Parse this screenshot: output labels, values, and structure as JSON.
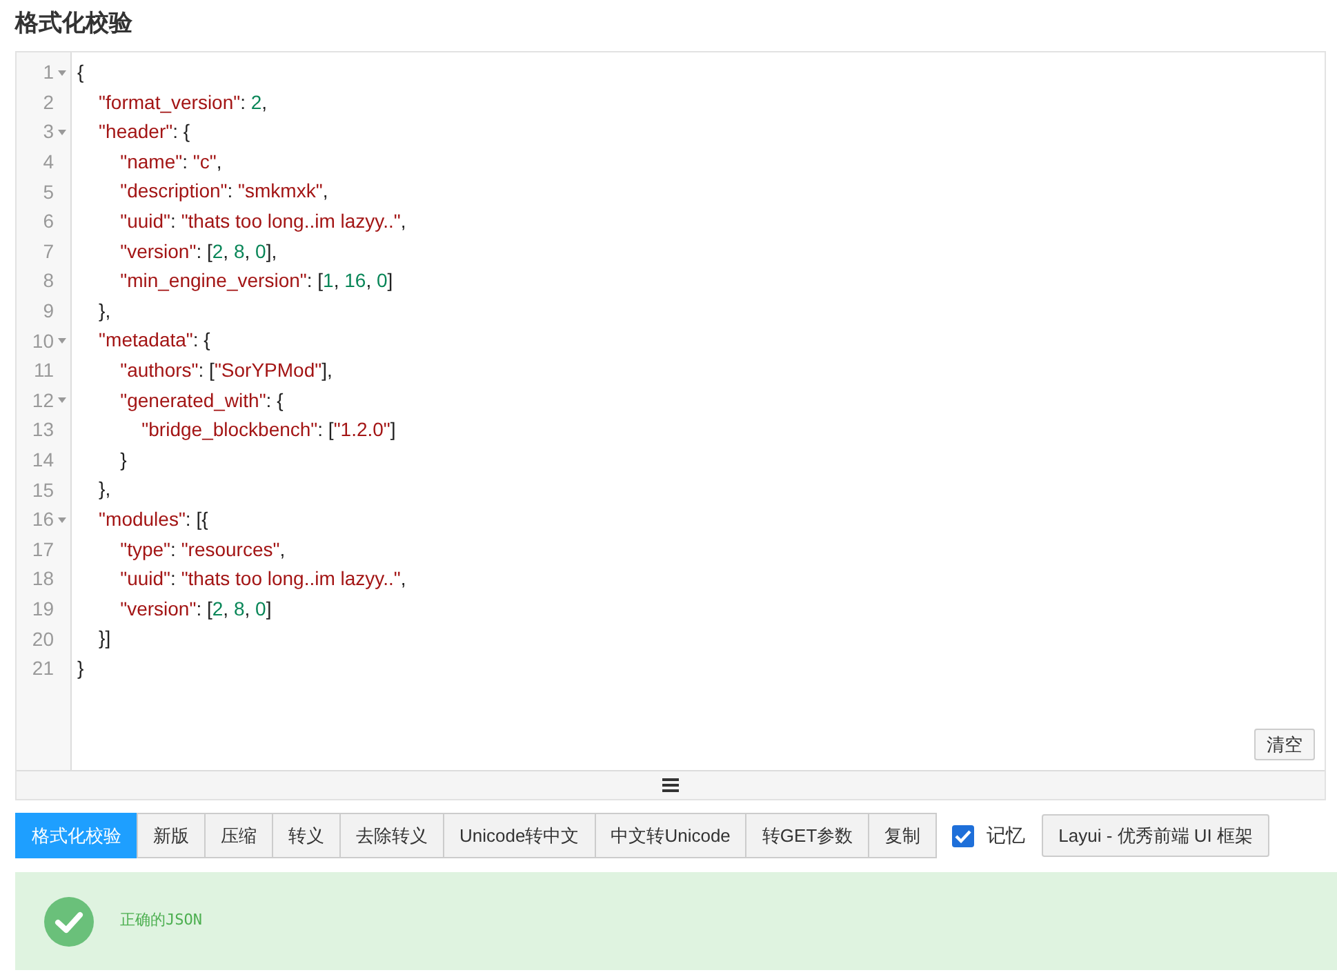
{
  "title": "格式化校验",
  "editor": {
    "lines": [
      {
        "number": "1",
        "foldable": true,
        "tokens": [
          {
            "kind": "punct",
            "text": "{"
          }
        ]
      },
      {
        "number": "2",
        "foldable": false,
        "tokens": [
          {
            "kind": "key",
            "text": "    \"format_version\""
          },
          {
            "kind": "punct",
            "text": ": "
          },
          {
            "kind": "number",
            "text": "2"
          },
          {
            "kind": "punct",
            "text": ","
          }
        ]
      },
      {
        "number": "3",
        "foldable": true,
        "tokens": [
          {
            "kind": "key",
            "text": "    \"header\""
          },
          {
            "kind": "punct",
            "text": ": {"
          }
        ]
      },
      {
        "number": "4",
        "foldable": false,
        "tokens": [
          {
            "kind": "key",
            "text": "        \"name\""
          },
          {
            "kind": "punct",
            "text": ": "
          },
          {
            "kind": "string",
            "text": "\"c\""
          },
          {
            "kind": "punct",
            "text": ","
          }
        ]
      },
      {
        "number": "5",
        "foldable": false,
        "tokens": [
          {
            "kind": "key",
            "text": "        \"description\""
          },
          {
            "kind": "punct",
            "text": ": "
          },
          {
            "kind": "string",
            "text": "\"smkmxk\""
          },
          {
            "kind": "punct",
            "text": ","
          }
        ]
      },
      {
        "number": "6",
        "foldable": false,
        "tokens": [
          {
            "kind": "key",
            "text": "        \"uuid\""
          },
          {
            "kind": "punct",
            "text": ": "
          },
          {
            "kind": "string",
            "text": "\"thats too long..im lazyy..\""
          },
          {
            "kind": "punct",
            "text": ","
          }
        ]
      },
      {
        "number": "7",
        "foldable": false,
        "tokens": [
          {
            "kind": "key",
            "text": "        \"version\""
          },
          {
            "kind": "punct",
            "text": ": ["
          },
          {
            "kind": "number",
            "text": "2"
          },
          {
            "kind": "punct",
            "text": ", "
          },
          {
            "kind": "number",
            "text": "8"
          },
          {
            "kind": "punct",
            "text": ", "
          },
          {
            "kind": "number",
            "text": "0"
          },
          {
            "kind": "punct",
            "text": "],"
          }
        ]
      },
      {
        "number": "8",
        "foldable": false,
        "tokens": [
          {
            "kind": "key",
            "text": "        \"min_engine_version\""
          },
          {
            "kind": "punct",
            "text": ": ["
          },
          {
            "kind": "number",
            "text": "1"
          },
          {
            "kind": "punct",
            "text": ", "
          },
          {
            "kind": "number",
            "text": "16"
          },
          {
            "kind": "punct",
            "text": ", "
          },
          {
            "kind": "number",
            "text": "0"
          },
          {
            "kind": "punct",
            "text": "]"
          }
        ]
      },
      {
        "number": "9",
        "foldable": false,
        "tokens": [
          {
            "kind": "punct",
            "text": "    },"
          }
        ]
      },
      {
        "number": "10",
        "foldable": true,
        "tokens": [
          {
            "kind": "key",
            "text": "    \"metadata\""
          },
          {
            "kind": "punct",
            "text": ": {"
          }
        ]
      },
      {
        "number": "11",
        "foldable": false,
        "tokens": [
          {
            "kind": "key",
            "text": "        \"authors\""
          },
          {
            "kind": "punct",
            "text": ": ["
          },
          {
            "kind": "string",
            "text": "\"SorYPMod\""
          },
          {
            "kind": "punct",
            "text": "],"
          }
        ]
      },
      {
        "number": "12",
        "foldable": true,
        "tokens": [
          {
            "kind": "key",
            "text": "        \"generated_with\""
          },
          {
            "kind": "punct",
            "text": ": {"
          }
        ]
      },
      {
        "number": "13",
        "foldable": false,
        "tokens": [
          {
            "kind": "key",
            "text": "            \"bridge_blockbench\""
          },
          {
            "kind": "punct",
            "text": ": ["
          },
          {
            "kind": "string",
            "text": "\"1.2.0\""
          },
          {
            "kind": "punct",
            "text": "]"
          }
        ]
      },
      {
        "number": "14",
        "foldable": false,
        "tokens": [
          {
            "kind": "punct",
            "text": "        }"
          }
        ]
      },
      {
        "number": "15",
        "foldable": false,
        "tokens": [
          {
            "kind": "punct",
            "text": "    },"
          }
        ]
      },
      {
        "number": "16",
        "foldable": true,
        "tokens": [
          {
            "kind": "key",
            "text": "    \"modules\""
          },
          {
            "kind": "punct",
            "text": ": [{"
          }
        ]
      },
      {
        "number": "17",
        "foldable": false,
        "tokens": [
          {
            "kind": "key",
            "text": "        \"type\""
          },
          {
            "kind": "punct",
            "text": ": "
          },
          {
            "kind": "string",
            "text": "\"resources\""
          },
          {
            "kind": "punct",
            "text": ","
          }
        ]
      },
      {
        "number": "18",
        "foldable": false,
        "tokens": [
          {
            "kind": "key",
            "text": "        \"uuid\""
          },
          {
            "kind": "punct",
            "text": ": "
          },
          {
            "kind": "string",
            "text": "\"thats too long..im lazyy..\""
          },
          {
            "kind": "punct",
            "text": ","
          }
        ]
      },
      {
        "number": "19",
        "foldable": false,
        "tokens": [
          {
            "kind": "key",
            "text": "        \"version\""
          },
          {
            "kind": "punct",
            "text": ": ["
          },
          {
            "kind": "number",
            "text": "2"
          },
          {
            "kind": "punct",
            "text": ", "
          },
          {
            "kind": "number",
            "text": "8"
          },
          {
            "kind": "punct",
            "text": ", "
          },
          {
            "kind": "number",
            "text": "0"
          },
          {
            "kind": "punct",
            "text": "]"
          }
        ]
      },
      {
        "number": "20",
        "foldable": false,
        "tokens": [
          {
            "kind": "punct",
            "text": "    }]"
          }
        ]
      },
      {
        "number": "21",
        "foldable": false,
        "tokens": [
          {
            "kind": "punct",
            "text": "}"
          }
        ]
      }
    ],
    "clear_button": "清空"
  },
  "toolbar": {
    "buttons": [
      {
        "label": "格式化校验",
        "selected": true
      },
      {
        "label": "新版",
        "selected": false
      },
      {
        "label": "压缩",
        "selected": false
      },
      {
        "label": "转义",
        "selected": false
      },
      {
        "label": "去除转义",
        "selected": false
      },
      {
        "label": "Unicode转中文",
        "selected": false
      },
      {
        "label": "中文转Unicode",
        "selected": false
      },
      {
        "label": "转GET参数",
        "selected": false
      },
      {
        "label": "复制",
        "selected": false
      }
    ],
    "remember": {
      "label": "记忆",
      "checked": true
    },
    "link_button": "Layui - 优秀前端 UI 框架"
  },
  "result": {
    "message": "正确的JSON"
  }
}
